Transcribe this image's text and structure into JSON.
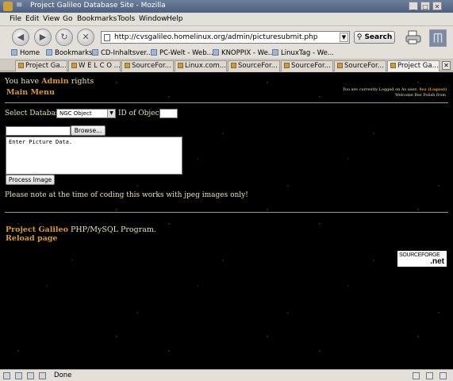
{
  "window": {
    "title": "Project Galileo Database Site - Mozilla",
    "system_menu": "≡",
    "buttons": [
      "_",
      "□",
      "✕"
    ]
  },
  "menu": [
    "File",
    "Edit",
    "View",
    "Go",
    "Bookmarks",
    "Tools",
    "Window",
    "Help"
  ],
  "nav": {
    "back": "◀",
    "forward": "▶",
    "reload": "↻",
    "stop": "✕",
    "url": "http://cvsgalileo.homelinux.org/admin/picturesubmit.php",
    "search_label": "Search"
  },
  "bookmarks": [
    "Home",
    "Bookmarks",
    "CD-Inhaltsver...",
    "PC-Welt - Web...",
    "KNOPPIX - We...",
    "LinuxTag - We..."
  ],
  "tabs": [
    "Project Ga...",
    "W E L C O ...",
    "SourceFor...",
    "Linux.com...",
    "SourceFor...",
    "SourceFor...",
    "SourceFor...",
    "Project Ga..."
  ],
  "active_tab_index": 7,
  "page": {
    "rights_prefix": "You have",
    "rights_role": "Admin",
    "rights_suffix": "rights",
    "main_menu": "Main Menu",
    "logged_prefix": "You are currently Logged on As user:",
    "logged_user": "4ez",
    "logout": "(Logout)",
    "welcome": "Welcome Bez Polish from",
    "select_db_label": "Select Database",
    "db_selected": "NGC Object",
    "object_id_label": "ID of Object",
    "browse_label": "Browse...",
    "textarea_value": "Enter Picture Data.",
    "process_label": "Process Image",
    "note": "Please note at the time of coding this works with jpeg images only!",
    "footer_project": "Project Galileo",
    "footer_suffix": "PHP/MySQL Program.",
    "reload": "Reload page",
    "badge_source": "SOURCEFORGE",
    "badge_net": ".net"
  },
  "status": {
    "text": "Done"
  },
  "colors": {
    "page_bg": "#000000",
    "page_text": "#e8e1b4",
    "accent": "#d99a28",
    "chrome": "#e3e0da"
  }
}
